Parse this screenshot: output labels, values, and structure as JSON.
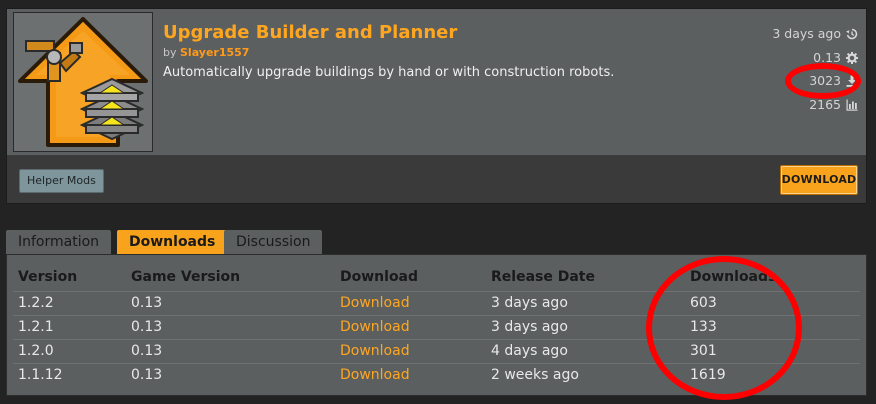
{
  "mod": {
    "title": "Upgrade Builder and Planner",
    "by": "by",
    "author": "Slayer1557",
    "summary": "Automatically upgrade buildings by hand or with construction robots.",
    "updated": "3 days ago",
    "game_version": "0.13",
    "downloads": "3023",
    "views": "2165",
    "tag": "Helper Mods",
    "download_label": "DOWNLOAD"
  },
  "tabs": [
    {
      "label": "Information",
      "active": false
    },
    {
      "label": "Downloads",
      "active": true
    },
    {
      "label": "Discussion",
      "active": false
    }
  ],
  "table": {
    "headers": [
      "Version",
      "Game Version",
      "Download",
      "Release Date",
      "Downloads"
    ],
    "rows": [
      {
        "version": "1.2.2",
        "game": "0.13",
        "link": "Download",
        "date": "3 days ago",
        "downloads": "603"
      },
      {
        "version": "1.2.1",
        "game": "0.13",
        "link": "Download",
        "date": "3 days ago",
        "downloads": "133"
      },
      {
        "version": "1.2.0",
        "game": "0.13",
        "link": "Download",
        "date": "4 days ago",
        "downloads": "301"
      },
      {
        "version": "1.1.12",
        "game": "0.13",
        "link": "Download",
        "date": "2 weeks ago",
        "downloads": "1619"
      }
    ]
  },
  "icons": {
    "updated": "history-icon",
    "version": "gear-icon",
    "downloads": "download-icon",
    "views": "bar-chart-icon"
  },
  "colors": {
    "accent": "#ffa620",
    "highlight_ring": "#ff0000",
    "panel": "#5b5f60"
  }
}
